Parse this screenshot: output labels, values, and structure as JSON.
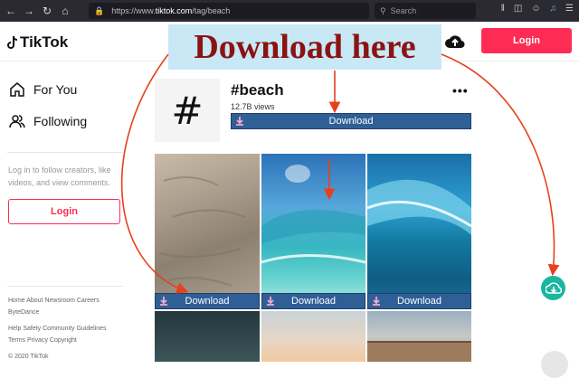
{
  "browser": {
    "url_prefix": "https://www.",
    "url_host": "tiktok.com",
    "url_path": "/tag/beach",
    "search_placeholder": "Search"
  },
  "header": {
    "logo": "TikTok",
    "login_label": "Login"
  },
  "banner": {
    "text": "Download here"
  },
  "sidebar": {
    "items": [
      {
        "label": "For You",
        "icon": "home-icon"
      },
      {
        "label": "Following",
        "icon": "people-icon"
      }
    ],
    "login_prompt": "Log in to follow creators, like videos, and view comments.",
    "login_label": "Login",
    "footer": {
      "line1": "Home  About  Newsroom  Careers",
      "line2": "ByteDance",
      "line3": "Help  Safety  Community Guidelines",
      "line4": "Terms  Privacy  Copyright",
      "line5": "© 2020 TikTok"
    }
  },
  "tag": {
    "symbol": "#",
    "title": "#beach",
    "views": "12.7B views",
    "download_label": "Download"
  },
  "videos": {
    "download_label": "Download",
    "tiles": [
      {
        "name": "sand"
      },
      {
        "name": "clear-water"
      },
      {
        "name": "wave"
      },
      {
        "name": "dark-sea"
      },
      {
        "name": "sunset"
      },
      {
        "name": "fence"
      }
    ]
  },
  "colors": {
    "brand": "#fe2c55",
    "download_bar": "#2f5f96",
    "banner_bg": "#c8e8f6",
    "banner_text": "#8b1313",
    "arrow": "#e8401c",
    "extension": "#19b6a0"
  }
}
